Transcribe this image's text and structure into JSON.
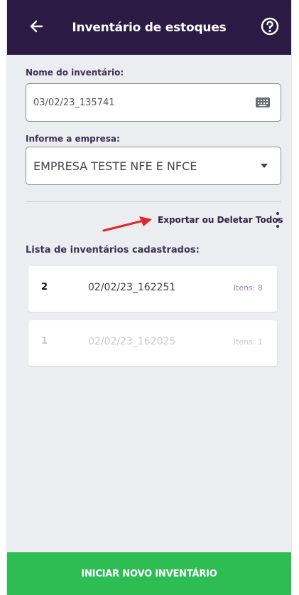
{
  "header": {
    "title": "Inventário de estoques",
    "back_icon": "arrow-left-icon",
    "help_icon": "help-circle-icon",
    "color": "#2b1a44"
  },
  "form": {
    "name_label": "Nome do inventário:",
    "name_value": "03/02/23_135741",
    "name_icon": "keyboard-icon",
    "company_label": "Informe a empresa:",
    "company_value": "EMPRESA TESTE NFE E NFCE",
    "company_icon": "chevron-down-icon"
  },
  "actions": {
    "export_label": "Exportar ou Deletar Todos",
    "menu_icon": "more-vertical-icon",
    "annotation_color": "#e0262a"
  },
  "list": {
    "title": "Lista de inventários cadastrados:",
    "items": [
      {
        "number": "2",
        "name": "02/02/23_162251",
        "items": "Itens: 8"
      },
      {
        "number": "1",
        "name": "02/02/23_162025",
        "items": "Itens: 1"
      }
    ],
    "items_color": "#a27fc2"
  },
  "footer": {
    "button_label": "INICIAR NOVO INVENTÁRIO",
    "color": "#2dbd53"
  }
}
